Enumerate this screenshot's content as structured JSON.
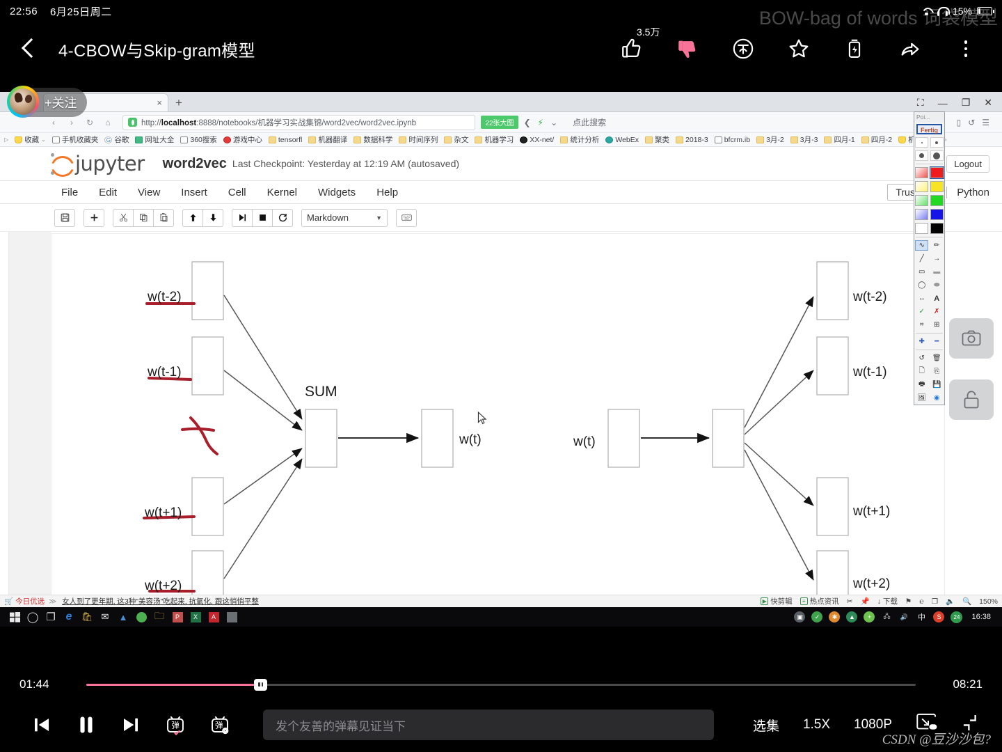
{
  "status_bar": {
    "time": "22:56",
    "date": "6月25日周二",
    "battery_percent": "15%",
    "wifi_icon": "wifi-icon",
    "headphone_icon": "headphone-icon",
    "battery_icon": "battery-icon"
  },
  "background_danmaku": "BOW-bag of words 词袋模型",
  "video": {
    "title": "4-CBOW与Skip-gram模型",
    "back_icon": "back-chevron-icon",
    "like_count": "3.5万",
    "actions": [
      {
        "name": "like-button",
        "icon": "thumbs-up-icon"
      },
      {
        "name": "dislike-button",
        "icon": "thumbs-down-icon"
      },
      {
        "name": "coin-button",
        "icon": "coin-icon"
      },
      {
        "name": "favorite-button",
        "icon": "star-icon"
      },
      {
        "name": "charge-button",
        "icon": "battery-charge-icon"
      },
      {
        "name": "share-button",
        "icon": "share-arrow-icon"
      },
      {
        "name": "more-button",
        "icon": "kebab-menu-icon"
      }
    ]
  },
  "uploader": {
    "follow_label": "+关注",
    "avatar_icon": "avatar"
  },
  "browser": {
    "tab_close_label": "×",
    "new_tab_label": "+",
    "window_controls": [
      "⛶",
      "—",
      "❐",
      "✕"
    ],
    "nav": {
      "back": "‹",
      "forward": "›",
      "reload": "↻",
      "home": "⌂"
    },
    "url_plain": "http://",
    "url_host": "localhost",
    "url_rest": ":8888/notebooks/机器学习实战集锦/word2vec/word2vec.ipynb",
    "zoom_badge": "22张大图",
    "search_hint": "点此搜索",
    "right_icons": [
      "▯",
      "↺",
      "☰"
    ],
    "bookmarks": [
      {
        "label": "收藏",
        "type": "st"
      },
      {
        "label": "手机收藏夹",
        "type": "bl"
      },
      {
        "label": "谷歌",
        "type": "g"
      },
      {
        "label": "网址大全",
        "type": "gr"
      },
      {
        "label": "360搜索",
        "type": "bl"
      },
      {
        "label": "游戏中心",
        "type": "rd"
      },
      {
        "label": "tensorfl",
        "type": "fo"
      },
      {
        "label": "机器翻译",
        "type": "fo"
      },
      {
        "label": "数据科学",
        "type": "fo"
      },
      {
        "label": "时间序列",
        "type": "fo"
      },
      {
        "label": "杂文",
        "type": "fo"
      },
      {
        "label": "机器学习",
        "type": "fo"
      },
      {
        "label": "XX-net/",
        "type": "bk"
      },
      {
        "label": "统计分析",
        "type": "fo"
      },
      {
        "label": "WebEx",
        "type": "tl"
      },
      {
        "label": "聚类",
        "type": "fo"
      },
      {
        "label": "2018-3",
        "type": "fo"
      },
      {
        "label": "bfcrm.ib",
        "type": "bl"
      },
      {
        "label": "3月-2",
        "type": "fo"
      },
      {
        "label": "3月-3",
        "type": "fo"
      },
      {
        "label": "四月-1",
        "type": "fo"
      },
      {
        "label": "四月-2",
        "type": "fo"
      },
      {
        "label": "机器学习",
        "type": "st"
      }
    ]
  },
  "jupyter": {
    "brand": "jupyter",
    "notebook_name": "word2vec",
    "checkpoint": "Last Checkpoint: Yesterday at 12:19 AM (autosaved)",
    "logout_label": "Logout",
    "menu": [
      "File",
      "Edit",
      "View",
      "Insert",
      "Cell",
      "Kernel",
      "Widgets",
      "Help"
    ],
    "trusted_label": "Trusted",
    "kernel_label": "Python",
    "toolbar": {
      "save_icon": "save-icon",
      "add_icon": "add-cell-icon",
      "cut_icon": "scissors-icon",
      "copy_icon": "copy-icon",
      "paste_icon": "paste-icon",
      "move_up_icon": "arrow-up-icon",
      "move_down_icon": "arrow-down-icon",
      "run_icon": "run-cell-icon",
      "stop_icon": "stop-icon",
      "restart_icon": "restart-icon",
      "keyboard_icon": "keyboard-icon",
      "cell_type": "Markdown",
      "cell_type_caret": "▼"
    }
  },
  "diagram": {
    "sum_label": "SUM",
    "cbow_inputs": [
      "w(t-2)",
      "w(t-1)",
      "w(t+1)",
      "w(t+2)"
    ],
    "cbow_output": "w(t)",
    "skipgram_input": "w(t)",
    "skipgram_outputs": [
      "w(t-2)",
      "w(t-1)",
      "w(t+1)",
      "w(t+2)"
    ],
    "annotation_color": "#a81f2b"
  },
  "annot_panel": {
    "title": "Poi...",
    "done_label": "Fertig",
    "colors": [
      "#ef5350",
      "#ee1c1c",
      "#fff176",
      "#f7e425",
      "#66e06a",
      "#22d822",
      "#7a7df5",
      "#1515e8",
      "#ffffff",
      "#000000"
    ],
    "tools": [
      "pen-icon",
      "eraser-icon",
      "line-icon",
      "arrow-icon",
      "rect-outline-icon",
      "rect-fill-icon",
      "ellipse-outline-icon",
      "ellipse-fill-icon",
      "resize-icon",
      "text-icon",
      "check-icon",
      "cross-icon",
      "crop-icon",
      "magnify-icon",
      "plus-icon",
      "minus-icon",
      "undo-icon",
      "trash-icon",
      "new-icon",
      "duplicate-icon",
      "print-icon",
      "save-icon",
      "image-icon",
      "info-icon"
    ]
  },
  "newsbar": {
    "tag": "今日优选",
    "headline": "女人到了更年期, 这3种\"美容汤\"吃起来, 抗氧化, 跟这悄悄平整",
    "right_items": [
      "快剪辑",
      "热点资讯",
      "下载",
      "150%"
    ]
  },
  "taskbar": {
    "time": "16:38",
    "ime": "中"
  },
  "player": {
    "current_time": "01:44",
    "duration": "08:21",
    "progress_percent": 21,
    "prev_icon": "previous-episode-icon",
    "pause_icon": "pause-icon",
    "next_icon": "next-episode-icon",
    "danmaku_toggle_icon": "danmaku-on-icon",
    "danmaku_settings_icon": "danmaku-settings-icon",
    "danmaku_placeholder": "发个友善的弹幕见证当下",
    "episode_label": "选集",
    "speed_label": "1.5X",
    "quality_label": "1080P",
    "pip_icon": "picture-in-picture-icon",
    "fullscreen_icon": "fullscreen-icon",
    "accent_color": "#fb7299"
  },
  "watermark": "CSDN @豆沙沙包?"
}
